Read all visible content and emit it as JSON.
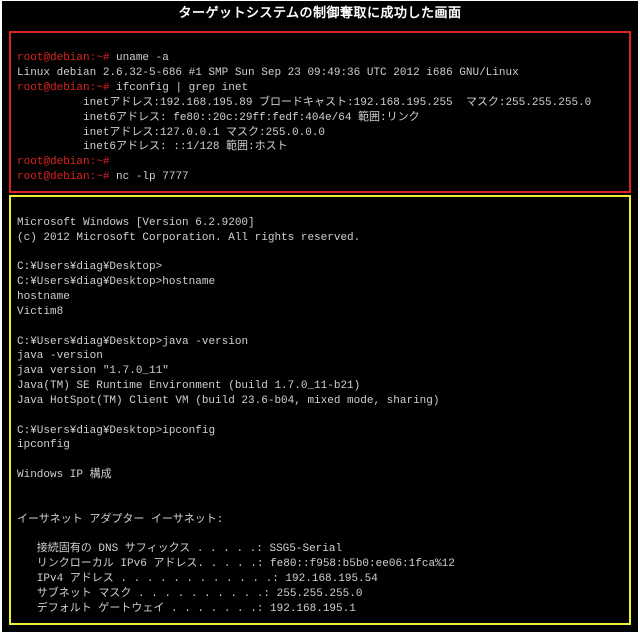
{
  "title": "ターゲットシステムの制御奪取に成功した画面",
  "linux": {
    "prompt": "root@debian:~#",
    "cmd_uname": "uname -a",
    "uname_out": "Linux debian 2.6.32-5-686 #1 SMP Sun Sep 23 09:49:36 UTC 2012 i686 GNU/Linux",
    "cmd_ifconfig": "ifconfig | grep inet",
    "ifc1": "          inetアドレス:192.168.195.89 ブロードキャスト:192.168.195.255  マスク:255.255.255.0",
    "ifc2": "          inet6アドレス: fe80::20c:29ff:fedf:404e/64 範囲:リンク",
    "ifc3": "          inetアドレス:127.0.0.1 マスク:255.0.0.0",
    "ifc4": "          inet6アドレス: ::1/128 範囲:ホスト",
    "cmd_nc": "nc -lp 7777"
  },
  "windows": {
    "ver": "Microsoft Windows [Version 6.2.9200]",
    "copy": "(c) 2012 Microsoft Corporation. All rights reserved.",
    "prompt": "C:¥Users¥diag¥Desktop>",
    "cmd_hostname": "hostname",
    "echo_hostname": "hostname",
    "hostname_out": "Victim8",
    "cmd_java": "java -version",
    "echo_java": "java -version",
    "java1": "java version \"1.7.0_11\"",
    "java2": "Java(TM) SE Runtime Environment (build 1.7.0_11-b21)",
    "java3": "Java HotSpot(TM) Client VM (build 23.6-b04, mixed mode, sharing)",
    "cmd_ipconfig": "ipconfig",
    "echo_ipconfig": "ipconfig",
    "ipcfg_title": "Windows IP 構成",
    "adapter": "イーサネット アダプター イーサネット:",
    "dns": "   接続固有の DNS サフィックス . . . . .: SSG5-Serial",
    "ipv6": "   リンクローカル IPv6 アドレス. . . . .: fe80::f958:b5b0:ee06:1fca%12",
    "ipv4": "   IPv4 アドレス . . . . . . . . . . . .: 192.168.195.54",
    "mask": "   サブネット マスク . . . . . . . . . .: 255.255.255.0",
    "gw": "   デフォルト ゲートウェイ . . . . . . .: 192.168.195.1"
  }
}
